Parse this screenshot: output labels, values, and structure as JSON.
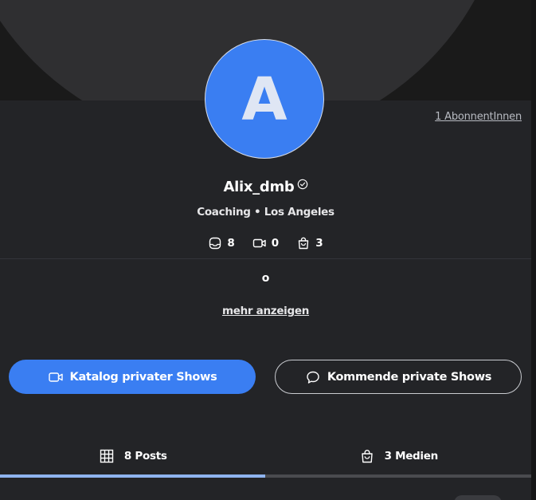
{
  "profile": {
    "avatar_letter": "A",
    "name": "Alix_dmb",
    "meta": "Coaching • Los Angeles",
    "subscribers": "1 AbonnentInnen",
    "bio": "o",
    "more_label": "mehr anzeigen"
  },
  "stats": {
    "posts": "8",
    "videos": "0",
    "media": "3"
  },
  "buttons": {
    "catalog_label": "Katalog privater Shows",
    "upcoming_label": "Kommende private Shows"
  },
  "tabs": [
    {
      "label": "8 Posts",
      "icon": "grid-icon",
      "active": true
    },
    {
      "label": "3 Medien",
      "icon": "bag-icon",
      "active": false
    }
  ],
  "colors": {
    "accent": "#3a7ef2",
    "background": "#232427",
    "tab_indicator": "#8fb4ef"
  }
}
